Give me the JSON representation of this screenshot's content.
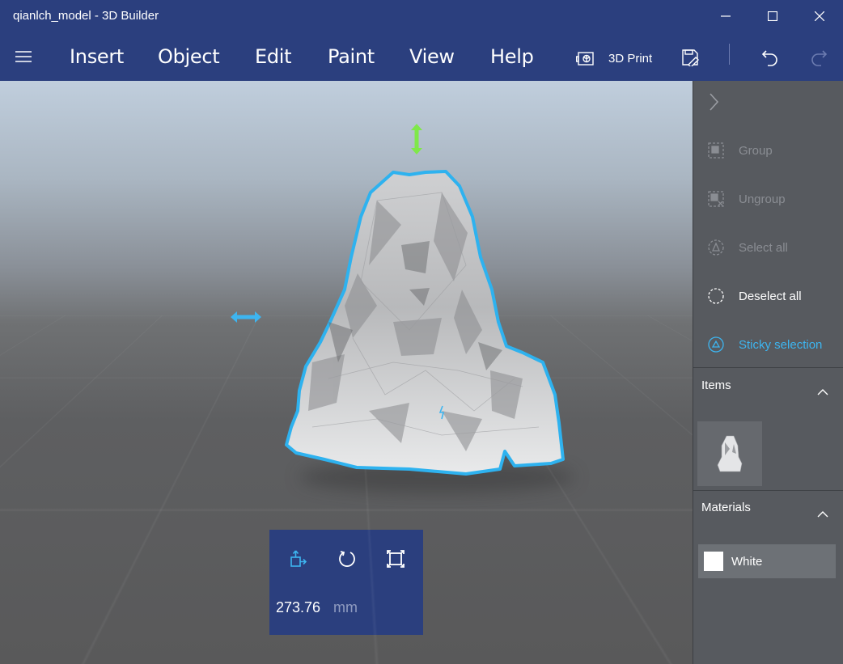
{
  "window": {
    "title": "qianlch_model - 3D Builder",
    "controls": [
      "minimize",
      "maximize",
      "close"
    ]
  },
  "menubar": {
    "items": [
      {
        "label": "Insert"
      },
      {
        "label": "Object"
      },
      {
        "label": "Edit"
      },
      {
        "label": "Paint"
      },
      {
        "label": "View"
      },
      {
        "label": "Help"
      }
    ],
    "print_label": "3D Print",
    "icons": [
      "menu-icon",
      "printer-3d-icon",
      "save-icon",
      "undo-icon",
      "redo-icon"
    ]
  },
  "transform": {
    "value": "273.76",
    "unit": "mm",
    "modes": [
      "move-icon",
      "rotate-icon",
      "scale-icon"
    ]
  },
  "panel": {
    "actions": [
      {
        "label": "Group",
        "state": "disabled",
        "icon": "group-icon"
      },
      {
        "label": "Ungroup",
        "state": "disabled",
        "icon": "ungroup-icon"
      },
      {
        "label": "Select all",
        "state": "disabled",
        "icon": "select-all-icon"
      },
      {
        "label": "Deselect all",
        "state": "enabled",
        "icon": "deselect-icon"
      },
      {
        "label": "Sticky selection",
        "state": "active",
        "icon": "sticky-selection-icon"
      }
    ],
    "items_label": "Items",
    "materials_label": "Materials",
    "material_name": "White",
    "material_color": "#ffffff"
  },
  "colors": {
    "chrome": "#2b3f7e",
    "accent": "#3db5f0",
    "gizmo_vertical": "#7fe84a",
    "panel_bg": "#575a5f"
  }
}
